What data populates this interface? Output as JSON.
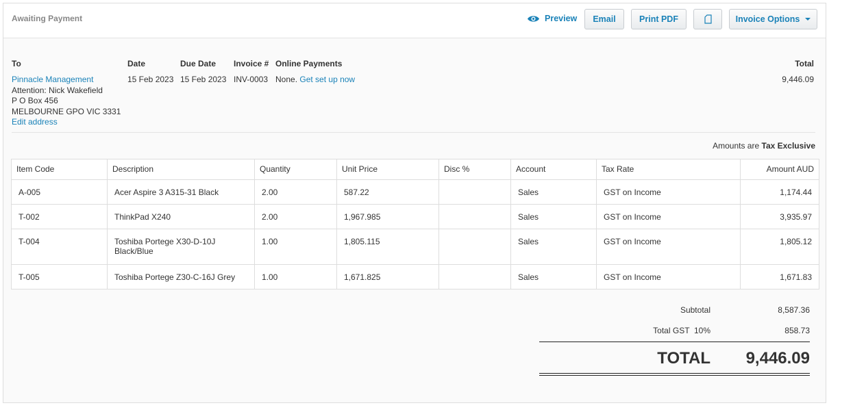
{
  "header": {
    "status": "Awaiting Payment",
    "preview": "Preview",
    "email": "Email",
    "print_pdf": "Print PDF",
    "invoice_options": "Invoice Options"
  },
  "details": {
    "to_label": "To",
    "date_label": "Date",
    "due_label": "Due Date",
    "invoice_label": "Invoice #",
    "online_label": "Online Payments",
    "total_label": "Total",
    "contact": "Pinnacle Management",
    "attention": "Attention: Nick Wakefield",
    "address1": "P O Box 456",
    "address2": "MELBOURNE GPO VIC 3331",
    "edit_address": "Edit address",
    "date": "15 Feb 2023",
    "due_date": "15 Feb 2023",
    "invoice_no": "INV-0003",
    "online_none": "None.",
    "online_link": "Get set up now",
    "total": "9,446.09"
  },
  "amounts_are": "Amounts are",
  "tax_mode": "Tax Exclusive",
  "table": {
    "columns": [
      "Item Code",
      "Description",
      "Quantity",
      "Unit Price",
      "Disc %",
      "Account",
      "Tax Rate",
      "Amount AUD"
    ],
    "rows": [
      [
        "A-005",
        "Acer Aspire 3 A315-31 Black",
        "2.00",
        "587.22",
        "",
        "Sales",
        "GST on Income",
        "1,174.44"
      ],
      [
        "T-002",
        "ThinkPad X240",
        "2.00",
        "1,967.985",
        "",
        "Sales",
        "GST on Income",
        "3,935.97"
      ],
      [
        "T-004",
        "Toshiba Portege X30-D-10J Black/Blue",
        "1.00",
        "1,805.115",
        "",
        "Sales",
        "GST on Income",
        "1,805.12"
      ],
      [
        "T-005",
        "Toshiba Portege Z30-C-16J Grey",
        "1.00",
        "1,671.825",
        "",
        "Sales",
        "GST on Income",
        "1,671.83"
      ]
    ]
  },
  "totals": {
    "subtotal_label": "Subtotal",
    "subtotal": "8,587.36",
    "gst_label": "Total GST  10%",
    "gst": "858.73",
    "total_label": "TOTAL",
    "total": "9,446.09"
  },
  "colors": {
    "link": "#1a82b8"
  }
}
